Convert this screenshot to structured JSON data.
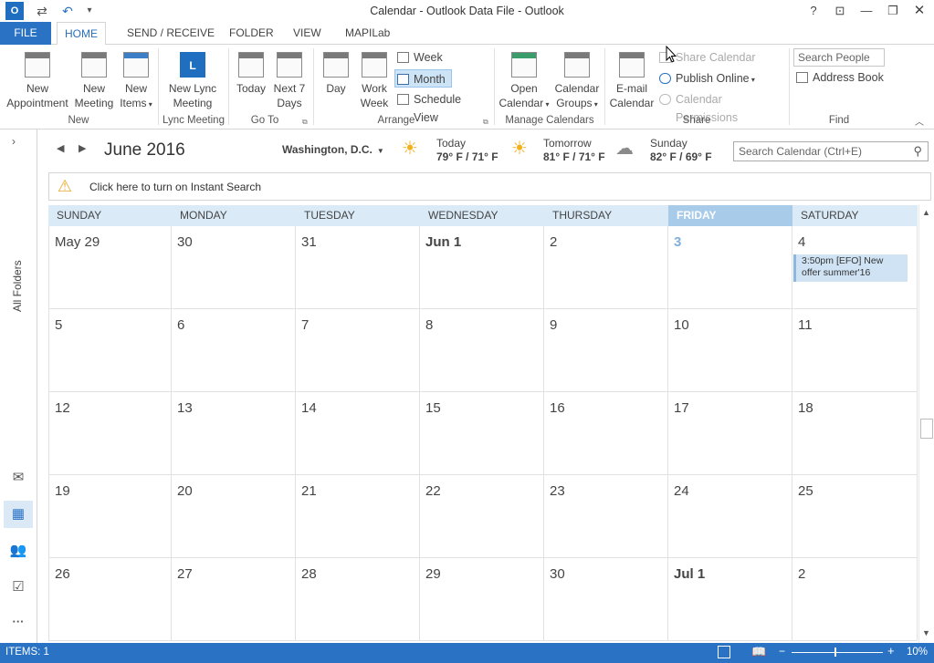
{
  "window": {
    "title": "Calendar - Outlook Data File - Outlook"
  },
  "tabs": [
    "FILE",
    "HOME",
    "SEND / RECEIVE",
    "FOLDER",
    "VIEW",
    "MAPILab"
  ],
  "ribbon": {
    "new_appointment": "New\nAppointment",
    "new_appointment_l1": "New",
    "new_appointment_l2": "Appointment",
    "new_meeting_l1": "New",
    "new_meeting_l2": "Meeting",
    "new_items_l1": "New",
    "new_items_l2": "Items",
    "new_lync_l1": "New Lync",
    "new_lync_l2": "Meeting",
    "today": "Today",
    "next7_l1": "Next 7",
    "next7_l2": "Days",
    "day": "Day",
    "workweek_l1": "Work",
    "workweek_l2": "Week",
    "week": "Week",
    "month": "Month",
    "schedule_view": "Schedule View",
    "open_cal_l1": "Open",
    "open_cal_l2": "Calendar",
    "cal_groups_l1": "Calendar",
    "cal_groups_l2": "Groups",
    "email_cal_l1": "E-mail",
    "email_cal_l2": "Calendar",
    "share_calendar": "Share Calendar",
    "publish_online": "Publish Online",
    "calendar_permissions": "Calendar Permissions",
    "search_people": "Search People",
    "address_book": "Address Book",
    "groups": [
      "New",
      "Lync Meeting",
      "Go To",
      "Arrange",
      "Manage Calendars",
      "Share",
      "Find"
    ]
  },
  "leftnav": {
    "all_folders": "All Folders"
  },
  "calendar": {
    "month_label": "June 2016",
    "location": "Washington, D.C.",
    "weather": [
      {
        "label": "Today",
        "temp": "79° F / 71° F"
      },
      {
        "label": "Tomorrow",
        "temp": "81° F / 71° F"
      },
      {
        "label": "Sunday",
        "temp": "82° F / 69° F"
      }
    ],
    "search_placeholder": "Search Calendar (Ctrl+E)",
    "info_text": "Click here to turn on Instant Search",
    "day_names": [
      "SUNDAY",
      "MONDAY",
      "TUESDAY",
      "WEDNESDAY",
      "THURSDAY",
      "FRIDAY",
      "SATURDAY"
    ],
    "weeks": [
      [
        "May 29",
        "30",
        "31",
        "Jun 1",
        "2",
        "3",
        "4"
      ],
      [
        "5",
        "6",
        "7",
        "8",
        "9",
        "10",
        "11"
      ],
      [
        "12",
        "13",
        "14",
        "15",
        "16",
        "17",
        "18"
      ],
      [
        "19",
        "20",
        "21",
        "22",
        "23",
        "24",
        "25"
      ],
      [
        "26",
        "27",
        "28",
        "29",
        "30",
        "Jul 1",
        "2"
      ]
    ],
    "event": {
      "line1": "3:50pm [EFO]  New",
      "line2": "offer summer'16"
    }
  },
  "status": {
    "items": "ITEMS: 1",
    "zoom": "10%"
  },
  "colors": {
    "accent": "#2a72c3",
    "today_header": "#a7cbe9",
    "today_text": "#7fb0de",
    "days_bg": "#daeaf7",
    "event_bg": "#cfe3f5"
  }
}
